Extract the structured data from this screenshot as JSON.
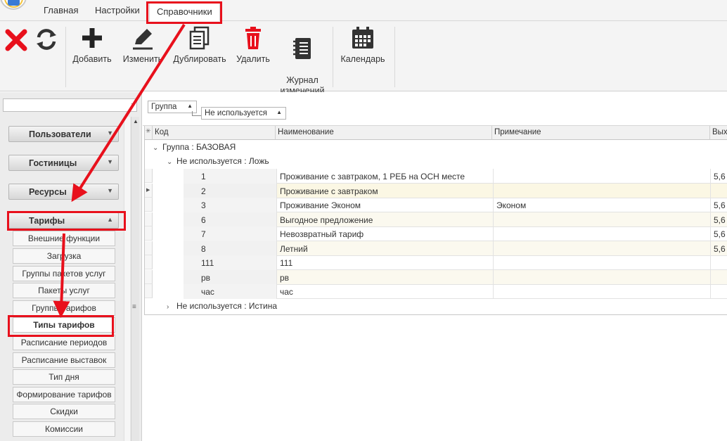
{
  "menu": {
    "tabs": [
      "Главная",
      "Настройки",
      "Справочники"
    ],
    "active_tab": "Справочники"
  },
  "ribbon": {
    "buttons": [
      {
        "label": "Добавить",
        "icon": "plus-icon"
      },
      {
        "label": "Изменить",
        "icon": "pencil-icon"
      },
      {
        "label": "Дублировать",
        "icon": "copy-icon"
      },
      {
        "label": "Удалить",
        "icon": "trash-icon"
      },
      {
        "label": "Журнал\nизменений",
        "icon": "journal-icon"
      },
      {
        "label": "Календарь",
        "icon": "calendar-icon"
      }
    ],
    "close_icon": "close-icon",
    "refresh_icon": "refresh-icon"
  },
  "sidebar": {
    "search_value": "",
    "categories": [
      {
        "label": "Пользователи",
        "expanded": false
      },
      {
        "label": "Гостиницы",
        "expanded": false
      },
      {
        "label": "Ресурсы",
        "expanded": false
      },
      {
        "label": "Тарифы",
        "expanded": true
      }
    ],
    "items": [
      "Внешние функции",
      "Загрузка",
      "Группы пакетов услуг",
      "Пакеты услуг",
      "Группы тарифов",
      "Типы тарифов",
      "Расписание периодов",
      "Расписание выставок",
      "Тип дня",
      "Формирование тарифов",
      "Скидки",
      "Комиссии"
    ],
    "selected_item": "Типы тарифов"
  },
  "grouping": {
    "chips": [
      "Группа",
      "Не используется"
    ]
  },
  "grid": {
    "columns": [
      "Код",
      "Наименование",
      "Примечание",
      "Выхо"
    ],
    "group_label": "Группа : БАЗОВАЯ",
    "subgroup_label": "Не используется : Ложь",
    "subgroup_collapsed_label": "Не используется : Истина",
    "rows": [
      {
        "code": "1",
        "name": "Проживание с завтраком, 1 РЕБ на ОСН месте",
        "note": "",
        "out": "5,6"
      },
      {
        "code": "2",
        "name": "Проживание с завтраком",
        "note": "",
        "out": ""
      },
      {
        "code": "3",
        "name": "Проживание Эконом",
        "note": "Эконом",
        "out": "5,6"
      },
      {
        "code": "6",
        "name": "Выгодное предложение",
        "note": "",
        "out": "5,6"
      },
      {
        "code": "7",
        "name": "Невозвратный тариф",
        "note": "",
        "out": "5,6"
      },
      {
        "code": "8",
        "name": "Летний",
        "note": "",
        "out": "5,6"
      },
      {
        "code": "111",
        "name": "111",
        "note": "",
        "out": ""
      },
      {
        "code": "рв",
        "name": "рв",
        "note": "",
        "out": ""
      },
      {
        "code": "час",
        "name": "час",
        "note": "",
        "out": ""
      }
    ],
    "current_row_index": 1
  },
  "colors": {
    "annotation": "#e8101c",
    "close_icon": "#e8101c",
    "delete_icon": "#e8101c"
  }
}
